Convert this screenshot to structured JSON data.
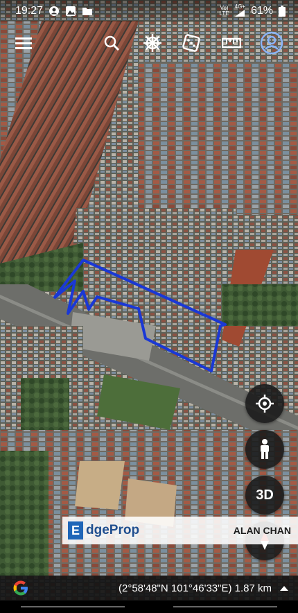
{
  "status_bar": {
    "time": "19:27",
    "net_top": "Vo)",
    "net_bottom": "LTE",
    "net2_top": "4G+",
    "battery": "61%"
  },
  "toolbar": {
    "menu_icon": "hamburger-menu-icon",
    "search_icon": "search-icon",
    "voyager_icon": "ship-wheel-icon",
    "random_icon": "dice-icon",
    "measure_icon": "ruler-icon",
    "profile_icon": "account-icon"
  },
  "controls": {
    "locate_icon": "crosshair-icon",
    "streetview_icon": "pegman-icon",
    "view_3d_label": "3D",
    "compass_icon": "compass-icon"
  },
  "watermark": {
    "logo_letter": "E",
    "brand": "dgeProp",
    "agent": "ALAN CHAN"
  },
  "bottom_bar": {
    "google_logo": "G",
    "coordinates": "(2°58'48\"N 101°46'33\"E) 1.87 km"
  },
  "colors": {
    "boundary": "#1a38d6",
    "accent_blue": "#8ab4f8",
    "brand_blue": "#1f66b8"
  }
}
